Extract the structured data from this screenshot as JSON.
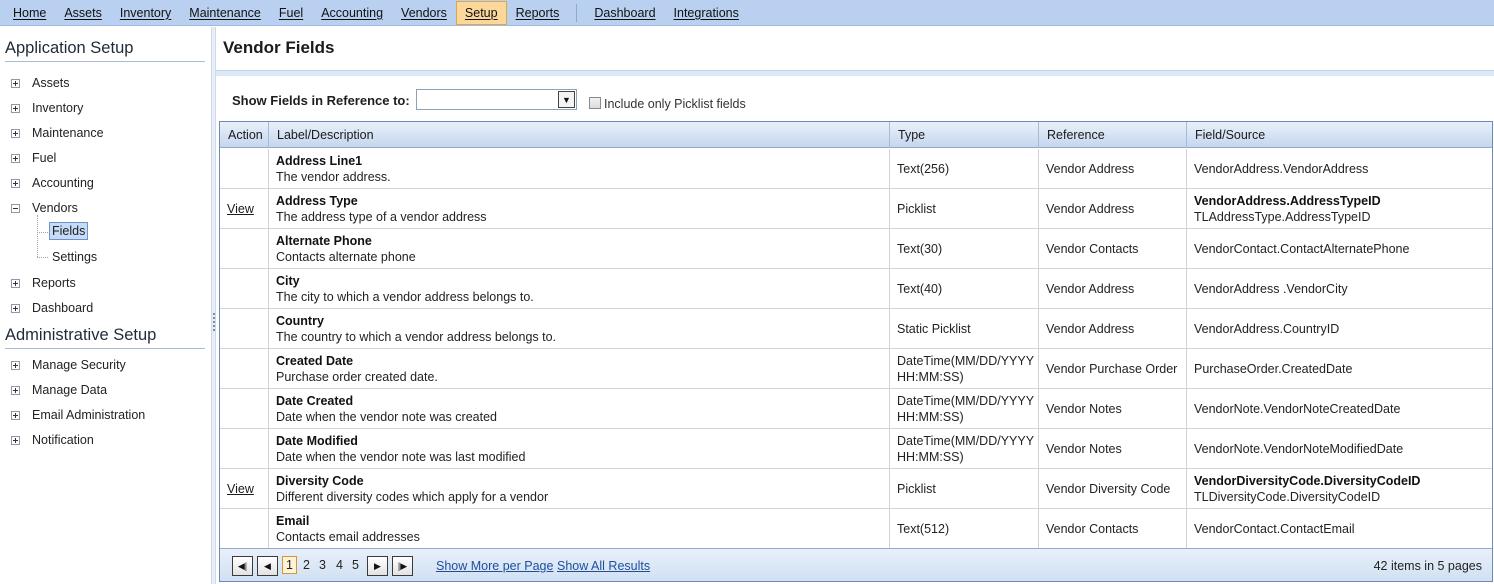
{
  "menu": {
    "items": [
      "Home",
      "Assets",
      "Inventory",
      "Maintenance",
      "Fuel",
      "Accounting",
      "Vendors",
      "Setup",
      "Reports"
    ],
    "items_right": [
      "Dashboard",
      "Integrations"
    ],
    "active": "Setup"
  },
  "sidebar": {
    "app_setup_title": "Application Setup",
    "app_items": [
      "Assets",
      "Inventory",
      "Maintenance",
      "Fuel",
      "Accounting",
      "Vendors",
      "Reports",
      "Dashboard"
    ],
    "vendor_children": [
      "Fields",
      "Settings"
    ],
    "selected": "Fields",
    "admin_setup_title": "Administrative Setup",
    "admin_items": [
      "Manage Security",
      "Manage Data",
      "Email Administration",
      "Notification"
    ]
  },
  "page": {
    "title": "Vendor Fields",
    "filter_label": "Show Fields in Reference to:",
    "filter_value": "",
    "picklist_only_label": "Include only Picklist fields",
    "picklist_only_checked": false
  },
  "grid": {
    "columns": [
      "Action",
      "Label/Description",
      "Type",
      "Reference",
      "Field/Source"
    ],
    "rows": [
      {
        "action": "",
        "label": "Address Line1",
        "desc": "The vendor address.",
        "type1": "Text(256)",
        "type2": "",
        "reference": "Vendor Address",
        "source1": "VendorAddress.VendorAddress",
        "source2": "",
        "source_bold": false
      },
      {
        "action": "View",
        "label": "Address Type",
        "desc": "The address type of a vendor address",
        "type1": "Picklist",
        "type2": "",
        "reference": "Vendor Address",
        "source1": "VendorAddress.AddressTypeID",
        "source2": "TLAddressType.AddressTypeID",
        "source_bold": true
      },
      {
        "action": "",
        "label": "Alternate Phone",
        "desc": "Contacts alternate phone",
        "type1": "Text(30)",
        "type2": "",
        "reference": "Vendor Contacts",
        "source1": "VendorContact.ContactAlternatePhone",
        "source2": "",
        "source_bold": false
      },
      {
        "action": "",
        "label": "City",
        "desc": "The city to which a vendor address belongs to.",
        "type1": "Text(40)",
        "type2": "",
        "reference": "Vendor Address",
        "source1": "VendorAddress .VendorCity",
        "source2": "",
        "source_bold": false
      },
      {
        "action": "",
        "label": "Country",
        "desc": "The country to which a vendor address belongs to.",
        "type1": "Static Picklist",
        "type2": "",
        "reference": "Vendor Address",
        "source1": "VendorAddress.CountryID",
        "source2": "",
        "source_bold": false
      },
      {
        "action": "",
        "label": "Created Date",
        "desc": "Purchase order created date.",
        "type1": "DateTime(MM/DD/YYYY",
        "type2": "HH:MM:SS)",
        "reference": "Vendor Purchase Order",
        "source1": "PurchaseOrder.CreatedDate",
        "source2": "",
        "source_bold": false
      },
      {
        "action": "",
        "label": "Date Created",
        "desc": "Date when the vendor note was created",
        "type1": "DateTime(MM/DD/YYYY",
        "type2": "HH:MM:SS)",
        "reference": "Vendor Notes",
        "source1": "VendorNote.VendorNoteCreatedDate",
        "source2": "",
        "source_bold": false
      },
      {
        "action": "",
        "label": "Date Modified",
        "desc": "Date when the vendor note was last modified",
        "type1": "DateTime(MM/DD/YYYY",
        "type2": "HH:MM:SS)",
        "reference": "Vendor Notes",
        "source1": "VendorNote.VendorNoteModifiedDate",
        "source2": "",
        "source_bold": false
      },
      {
        "action": "View",
        "label": "Diversity Code",
        "desc": "Different diversity codes which apply for a vendor",
        "type1": "Picklist",
        "type2": "",
        "reference": "Vendor Diversity Code",
        "source1": "VendorDiversityCode.DiversityCodeID",
        "source2": "TLDiversityCode.DiversityCodeID",
        "source_bold": true
      },
      {
        "action": "",
        "label": "Email",
        "desc": "Contacts email addresses",
        "type1": "Text(512)",
        "type2": "",
        "reference": "Vendor Contacts",
        "source1": "VendorContact.ContactEmail",
        "source2": "",
        "source_bold": false
      }
    ]
  },
  "pager": {
    "pages": [
      "1",
      "2",
      "3",
      "4",
      "5"
    ],
    "current_page": "1",
    "show_more_label": "Show More per Page",
    "show_all_label": "Show All Results",
    "summary": "42 items in 5 pages"
  }
}
